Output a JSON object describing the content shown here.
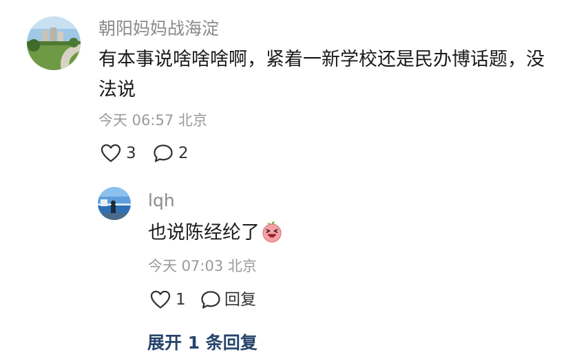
{
  "comment": {
    "author": "朝阳妈妈战海淀",
    "text": "有本事说啥啥啥啊，紧着一新学校还是民办博话题，没法说",
    "time": "今天 06:57",
    "location": "北京",
    "likes": "3",
    "replies": "2",
    "avatar_icon": "park-path-photo"
  },
  "reply": {
    "author": "lqh",
    "text": "也说陈经纶了",
    "emoji_icon": "laughing-peach-emoji",
    "time": "今天 07:03",
    "location": "北京",
    "likes": "1",
    "reply_label": "回复",
    "avatar_icon": "seaside-person-photo"
  },
  "expand_label": "展开 1 条回复",
  "colors": {
    "name": "#8a8a8a",
    "text": "#1a1a1a",
    "meta": "#9a9a9a",
    "expand_link": "#26436b"
  }
}
